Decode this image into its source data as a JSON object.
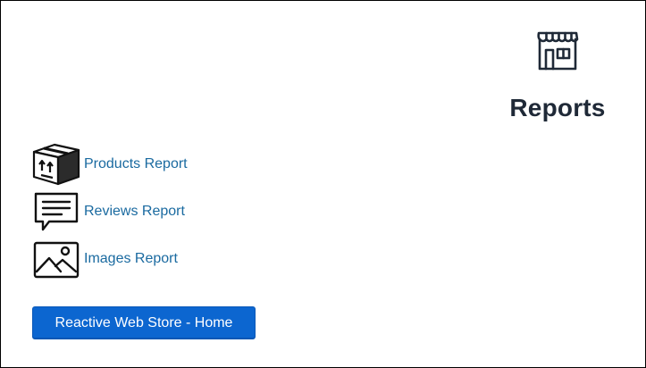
{
  "header": {
    "icon": "storefront-icon",
    "title": "Reports"
  },
  "reports": [
    {
      "label": "Products Report",
      "icon": "package-box-icon"
    },
    {
      "label": "Reviews Report",
      "icon": "chat-message-icon"
    },
    {
      "label": "Images Report",
      "icon": "image-landscape-icon"
    }
  ],
  "home_button": {
    "label": "Reactive Web Store - Home"
  },
  "colors": {
    "link": "#1a6aa0",
    "button": "#0c66d0",
    "title": "#1f2937"
  }
}
